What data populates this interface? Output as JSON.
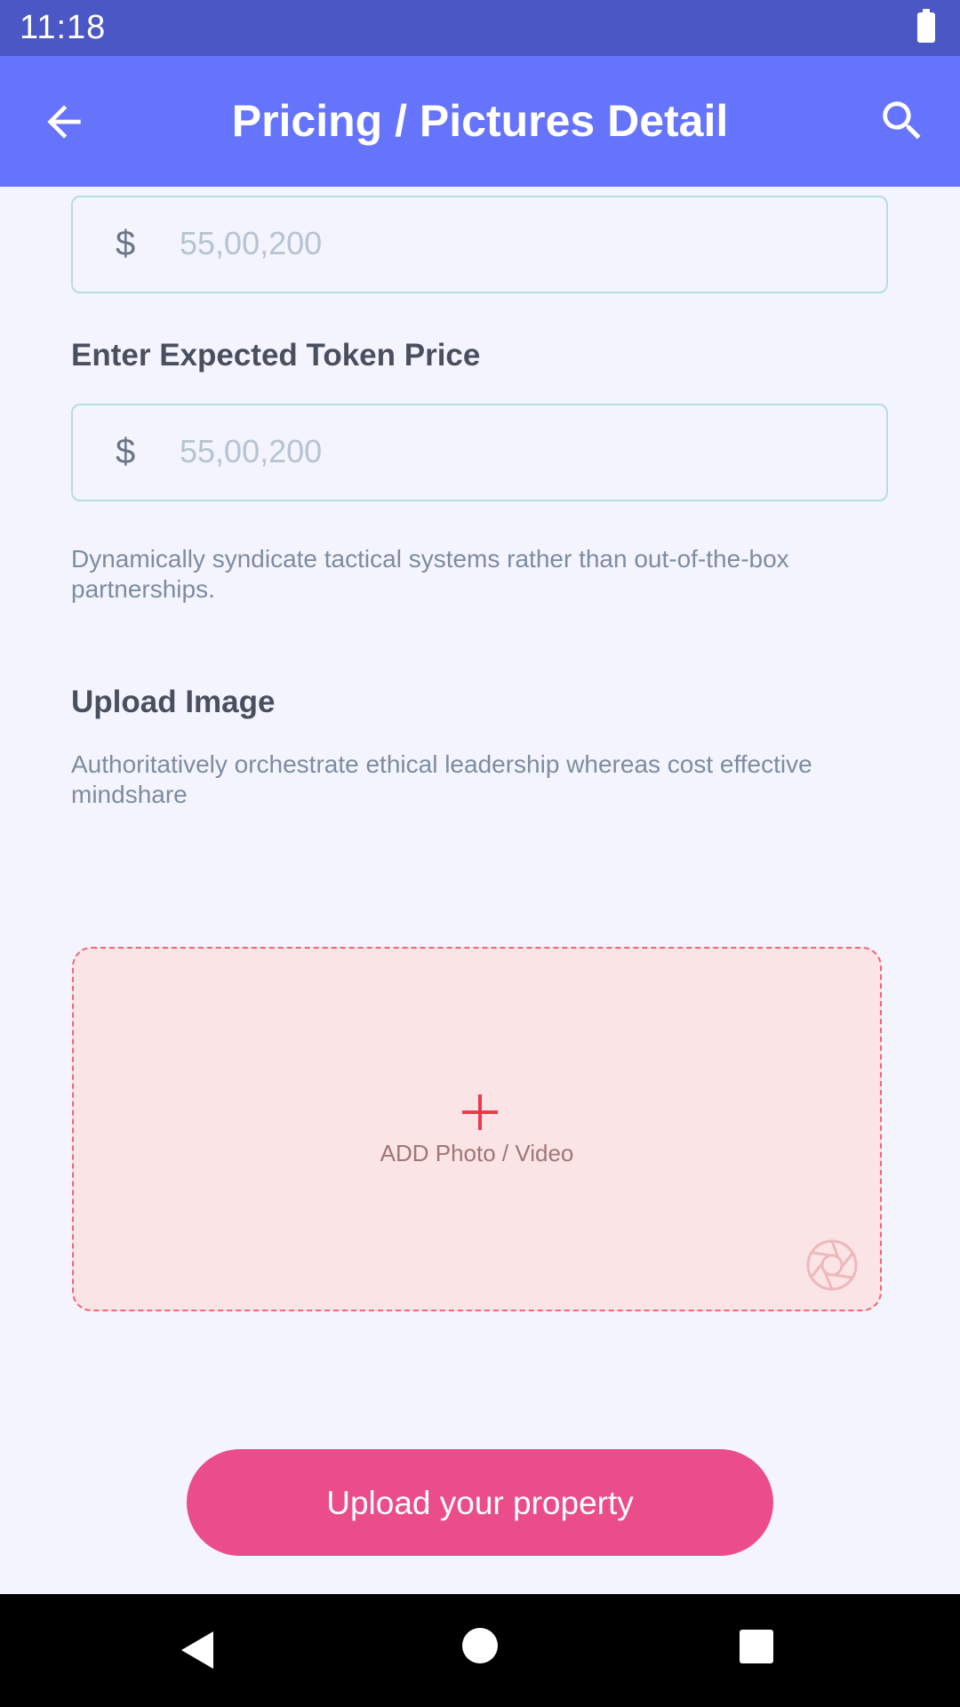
{
  "status_bar": {
    "time": "11:18",
    "battery_icon": "battery-full-icon"
  },
  "app_bar": {
    "title": "Pricing / Pictures Detail",
    "back_icon": "arrow-back-icon",
    "search_icon": "search-icon"
  },
  "fields": [
    {
      "currency": "$",
      "placeholder": "55,00,200"
    },
    {
      "label": "Enter Expected Token Price",
      "currency": "$",
      "placeholder": "55,00,200"
    }
  ],
  "token_note": "Dynamically syndicate tactical systems rather than out-of-the-box partnerships.",
  "upload": {
    "heading": "Upload Image",
    "description": "Authoritatively orchestrate ethical leadership whereas cost effective mindshare",
    "add_label": "ADD Photo / Video",
    "plus_icon": "plus-icon",
    "camera_icon": "camera-aperture-icon"
  },
  "cta": {
    "label": "Upload your property"
  },
  "colors": {
    "status_bar": "#4b57c4",
    "app_bar": "#6574fb",
    "background": "#f3f4fd",
    "cta": "#ea4d8a",
    "dropzone_fill": "#fae4e6",
    "dropzone_border": "#f06677",
    "plus": "#ee3a4a"
  }
}
